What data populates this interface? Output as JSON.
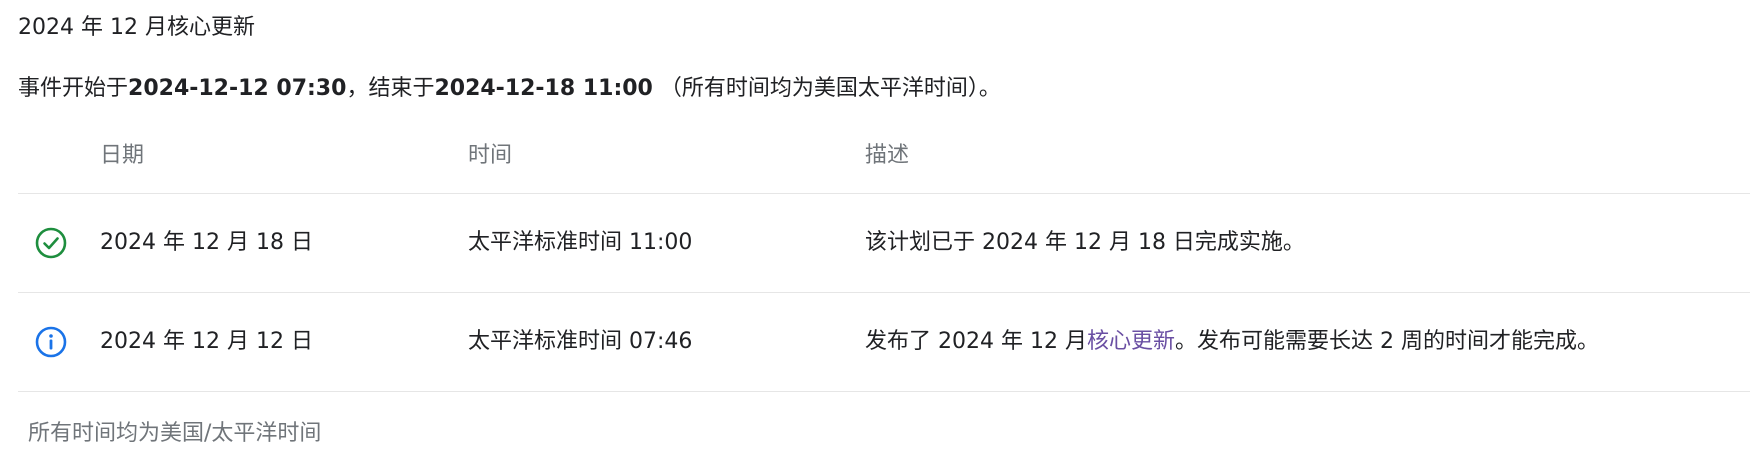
{
  "title": "2024 年 12 月核心更新",
  "summary": {
    "prefix": "事件开始于",
    "start": "2024-12-12 07:30",
    "middle": "，结束于",
    "end": "2024-12-18 11:00",
    "suffix": " （所有时间均为美国太平洋时间）。"
  },
  "table": {
    "headers": {
      "date": "日期",
      "time": "时间",
      "description": "描述"
    },
    "rows": [
      {
        "icon": "check-circle-icon",
        "date": "2024 年 12 月 18 日",
        "time": "太平洋标准时间 11:00",
        "description": "该计划已于 2024 年 12 月 18 日完成实施。"
      },
      {
        "icon": "info-icon",
        "date": "2024 年 12 月 12 日",
        "time": "太平洋标准时间 07:46",
        "desc_prefix": "发布了 2024 年 12 月",
        "desc_link": "核心更新",
        "desc_suffix": "。发布可能需要长达 2 周的时间才能完成。"
      }
    ]
  },
  "footer": "所有时间均为美国/太平洋时间",
  "colors": {
    "success": "#1e8e3e",
    "info": "#1a73e8",
    "link": "#6a4fa3",
    "muted": "#70757a"
  }
}
